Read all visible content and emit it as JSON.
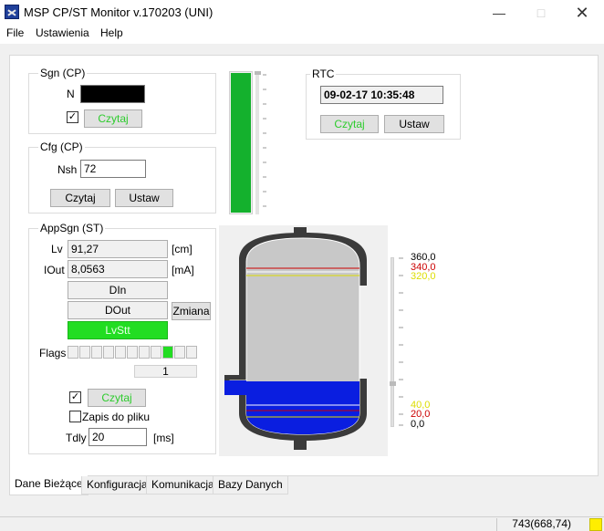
{
  "window": {
    "title": "MSP CP/ST Monitor v.170203 (UNI)"
  },
  "menu": {
    "items": [
      "File",
      "Ustawienia",
      "Help"
    ]
  },
  "sgn": {
    "label": "Sgn (CP)",
    "n_label": "N",
    "n_value": "",
    "checked": "✓",
    "read_button": "Czytaj"
  },
  "cfg": {
    "label": "Cfg (CP)",
    "nsh_label": "Nsh",
    "nsh_value": "72",
    "read_button": "Czytaj",
    "set_button": "Ustaw"
  },
  "rtc": {
    "label": "RTC",
    "datetime": "09-02-17 10:35:48",
    "read_button": "Czytaj",
    "set_button": "Ustaw"
  },
  "appsgn": {
    "label": "AppSgn (ST)",
    "lv_label": "Lv",
    "lv_value": "91,27",
    "lv_unit": "[cm]",
    "iout_label": "IOut",
    "iout_value": "8,0563",
    "iout_unit": "[mA]",
    "din_label": "DIn",
    "dout_label": "DOut",
    "change_button": "Zmiana",
    "lvstt_label": "LvStt",
    "flags_label": "Flags",
    "flags": [
      0,
      0,
      0,
      0,
      0,
      0,
      0,
      0,
      1,
      0,
      0
    ],
    "flag_value": "1",
    "checked": "✓",
    "read_button": "Czytaj",
    "log_label": "Zapis do pliku",
    "tdly_label": "Tdly",
    "tdly_value": "20",
    "tdly_unit": "[ms]"
  },
  "scale": {
    "top": "360,0",
    "high2": "340,0",
    "high1": "320,0",
    "low1": "40,0",
    "low2": "20,0",
    "bottom": "0,0"
  },
  "level_fraction": 0.25,
  "colors": {
    "ok_green": "#22dd22",
    "bar_green": "#14b12d",
    "liquid": "#0a1ee0",
    "high_alarm": "#cc0000",
    "warn": "#dddd00"
  },
  "tabs": [
    "Dane Bieżące",
    "Konfiguracja",
    "Komunikacja",
    "Bazy Danych"
  ],
  "status": {
    "text": "743(668,74)"
  }
}
